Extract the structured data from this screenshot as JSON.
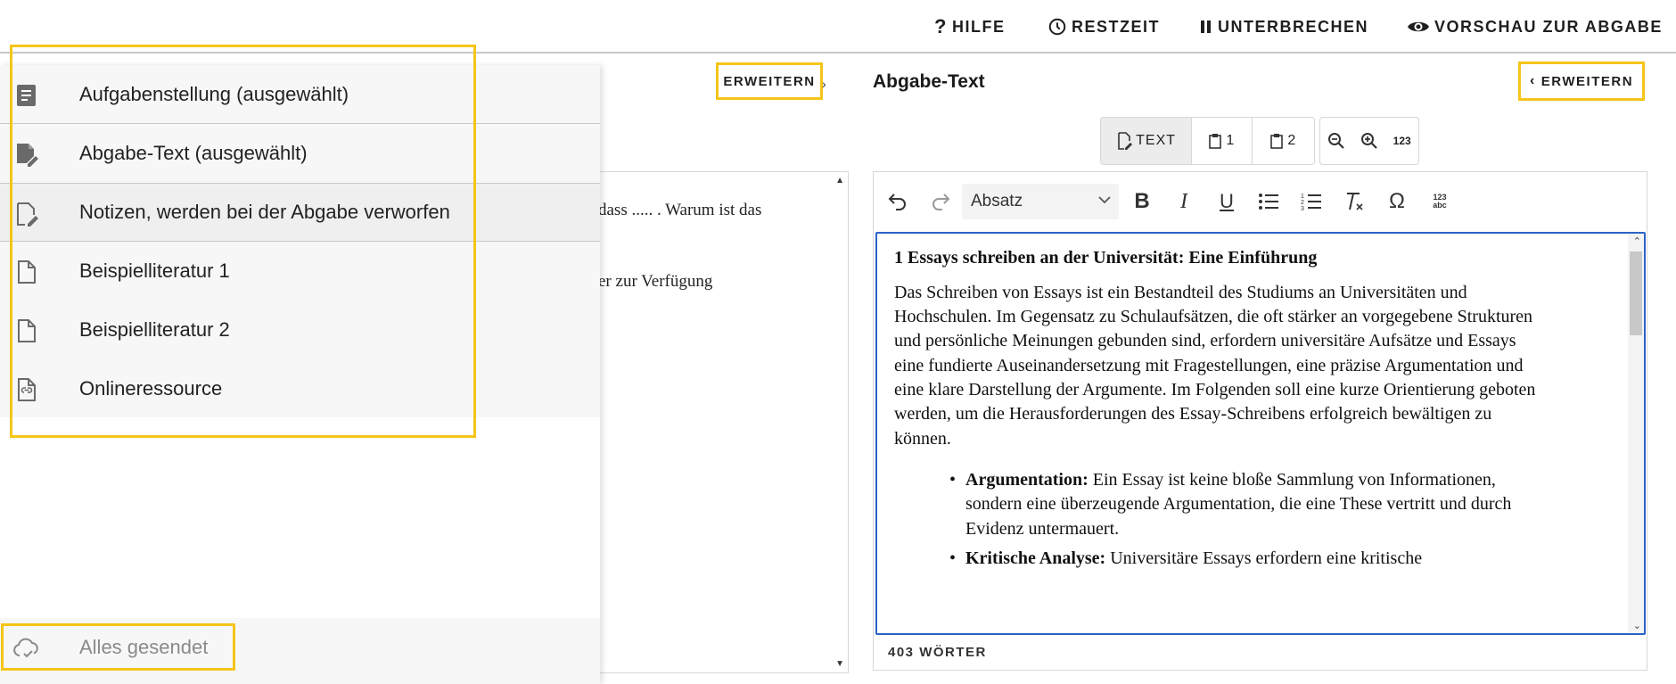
{
  "topbar": {
    "help": "HILFE",
    "remaining_time": "RESTZEIT",
    "pause": "UNTERBRECHEN",
    "preview": "VORSCHAU ZUR ABGABE"
  },
  "left_pane": {
    "expand_label": "ERWEITERN",
    "text_line_1": "dass ..... . Warum ist das",
    "text_line_2": "er zur Verfügung"
  },
  "drawer": {
    "items": [
      {
        "label": "Aufgabenstellung (ausgewählt)",
        "icon": "document-filled-icon"
      },
      {
        "label": "Abgabe-Text (ausgewählt)",
        "icon": "document-edit-filled-icon"
      },
      {
        "label": "Notizen, werden bei der Abgabe verworfen",
        "icon": "document-edit-outline-icon"
      },
      {
        "label": "Beispielliteratur 1",
        "icon": "file-outline-icon"
      },
      {
        "label": "Beispielliteratur 2",
        "icon": "file-outline-icon"
      },
      {
        "label": "Onlineressource",
        "icon": "link-file-icon"
      }
    ],
    "status": "Alles gesendet"
  },
  "right_pane": {
    "title": "Abgabe-Text",
    "expand_label": "ERWEITERN",
    "view_buttons": {
      "text": "TEXT",
      "one": "1",
      "two": "2"
    },
    "zoom_reset_label": "123",
    "paragraph_select": "Absatz",
    "special_char_label": "123 abc",
    "content": {
      "heading": "1 Essays schreiben an der Universität: Eine Einführung",
      "paragraph_lines": [
        "Das Schreiben von Essays ist ein Bestandteil des Studiums an Universitäten und",
        "Hochschulen. Im Gegensatz zu Schulaufsätzen, die oft stärker an vorgegebene Strukturen",
        "und persönliche Meinungen gebunden sind, erfordern universitäre Aufsätze und Essays",
        "eine fundierte Auseinandersetzung mit Fragestellungen, eine präzise Argumentation und",
        "eine klare Darstellung der Argumente. Im Folgenden soll eine kurze Orientierung geboten",
        "werden, um die Herausforderungen des Essay-Schreibens erfolgreich bewältigen zu",
        "können."
      ],
      "bullet_1_bold": "Argumentation:",
      "bullet_1_lines": [
        " Ein Essay ist keine bloße Sammlung von Informationen,",
        "sondern eine überzeugende Argumentation, die eine These vertritt und durch",
        "Evidenz untermauert."
      ],
      "bullet_2_bold": "Kritische Analyse:",
      "bullet_2_line": " Universitäre Essays erfordern eine kritische"
    },
    "word_count": "403 WÖRTER"
  },
  "colors": {
    "highlight": "#f5c518",
    "editor_focus": "#2b64c8"
  }
}
